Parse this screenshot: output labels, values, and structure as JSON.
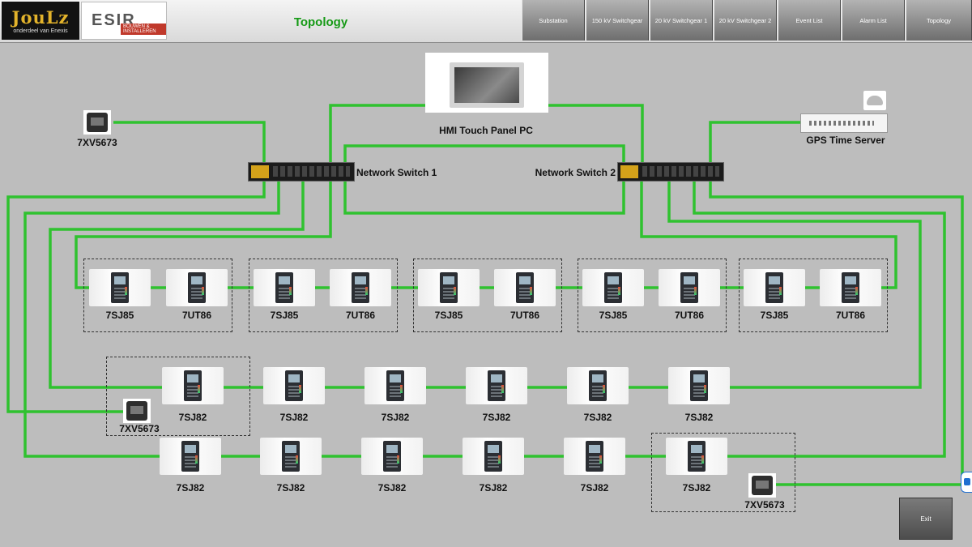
{
  "header": {
    "logo_joulz": {
      "brand": "JouLz",
      "subtitle": "onderdeel van Enexis"
    },
    "logo_esir": {
      "brand": "ESIR",
      "tag": "BOUWEN & INSTALLEREN"
    },
    "title": "Topology",
    "nav": [
      "Substation",
      "150 kV Switchgear",
      "20 kV Switchgear 1",
      "20 kV Switchgear 2",
      "Event List",
      "Alarm List",
      "Topology"
    ]
  },
  "devices": {
    "hmi": "HMI Touch Panel PC",
    "gps": "GPS Time Server",
    "switch1": "Network Switch 1",
    "switch2": "Network Switch 2",
    "clock_top": "7XV5673",
    "clock_mid": "7XV5673",
    "clock_bottom": "7XV5673",
    "row1": [
      "7SJ85",
      "7UT86",
      "7SJ85",
      "7UT86",
      "7SJ85",
      "7UT86",
      "7SJ85",
      "7UT86",
      "7SJ85",
      "7UT86"
    ],
    "row2": [
      "7SJ82",
      "7SJ82",
      "7SJ82",
      "7SJ82",
      "7SJ82",
      "7SJ82"
    ],
    "row3": [
      "7SJ82",
      "7SJ82",
      "7SJ82",
      "7SJ82",
      "7SJ82",
      "7SJ82"
    ]
  },
  "footer": {
    "exit": "Exit"
  },
  "colors": {
    "link": "#2fc22f",
    "title": "#169a16",
    "background": "#bdbdbd"
  }
}
